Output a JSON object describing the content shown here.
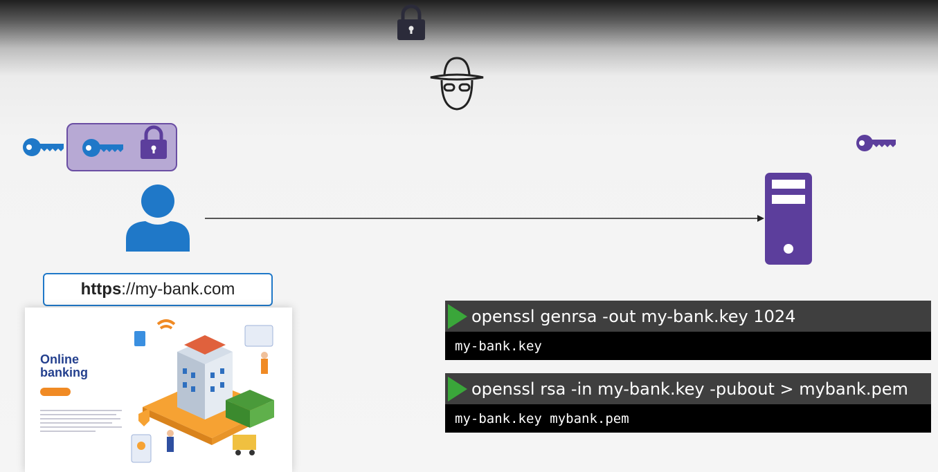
{
  "url_bar": {
    "scheme": "https",
    "rest": "://my-bank.com"
  },
  "website": {
    "title_line1": "Online",
    "title_line2": "banking"
  },
  "commands": [
    {
      "command": "openssl genrsa -out my-bank.key 1024",
      "output": "my-bank.key"
    },
    {
      "command": "openssl rsa -in my-bank.key -pubout > mybank.pem",
      "output": "my-bank.key mybank.pem"
    }
  ],
  "icons": {
    "top": "padlock-icon",
    "attacker": "hacker-icon",
    "client_key": "key-icon",
    "locked_box": "locked-key-box-icon",
    "user": "user-icon",
    "server_key": "key-icon",
    "server": "server-icon"
  },
  "colors": {
    "key_blue": "#1f78c8",
    "server_purple": "#5c3e9c",
    "box_fill": "#b7a9d4",
    "play_green": "#3aa63a"
  }
}
